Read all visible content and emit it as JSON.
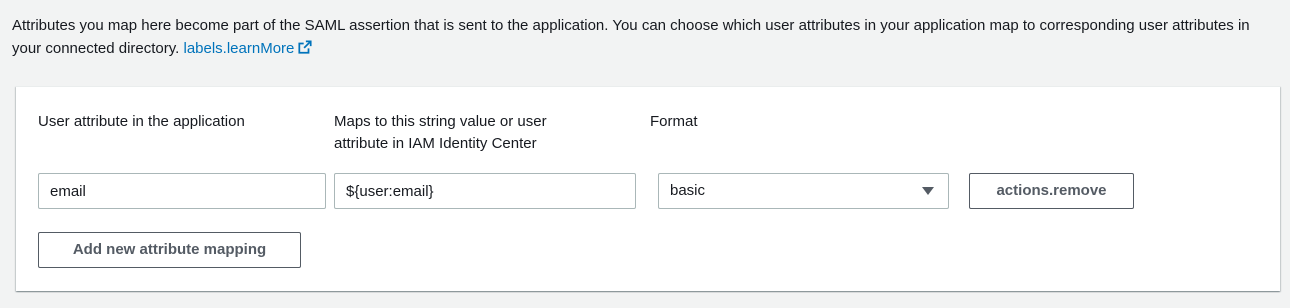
{
  "description": {
    "text": "Attributes you map here become part of the SAML assertion that is sent to the application. You can choose which user attributes in your application map to corresponding user attributes in your connected directory.",
    "learn_more_label": "labels.learnMore",
    "learn_more_icon": "external-link-icon"
  },
  "mapping": {
    "headers": {
      "user_attribute": "User attribute in the application",
      "maps_to": "Maps to this string value or user attribute in IAM Identity Center",
      "format": "Format"
    },
    "rows": [
      {
        "user_attribute": "email",
        "maps_to": "${user:email}",
        "format": "basic",
        "remove_label": "actions.remove"
      }
    ],
    "add_button_label": "Add new attribute mapping"
  },
  "colors": {
    "background": "#f2f3f3",
    "link": "#0073bb",
    "border": "#aab7b8",
    "button_text": "#545b64"
  }
}
